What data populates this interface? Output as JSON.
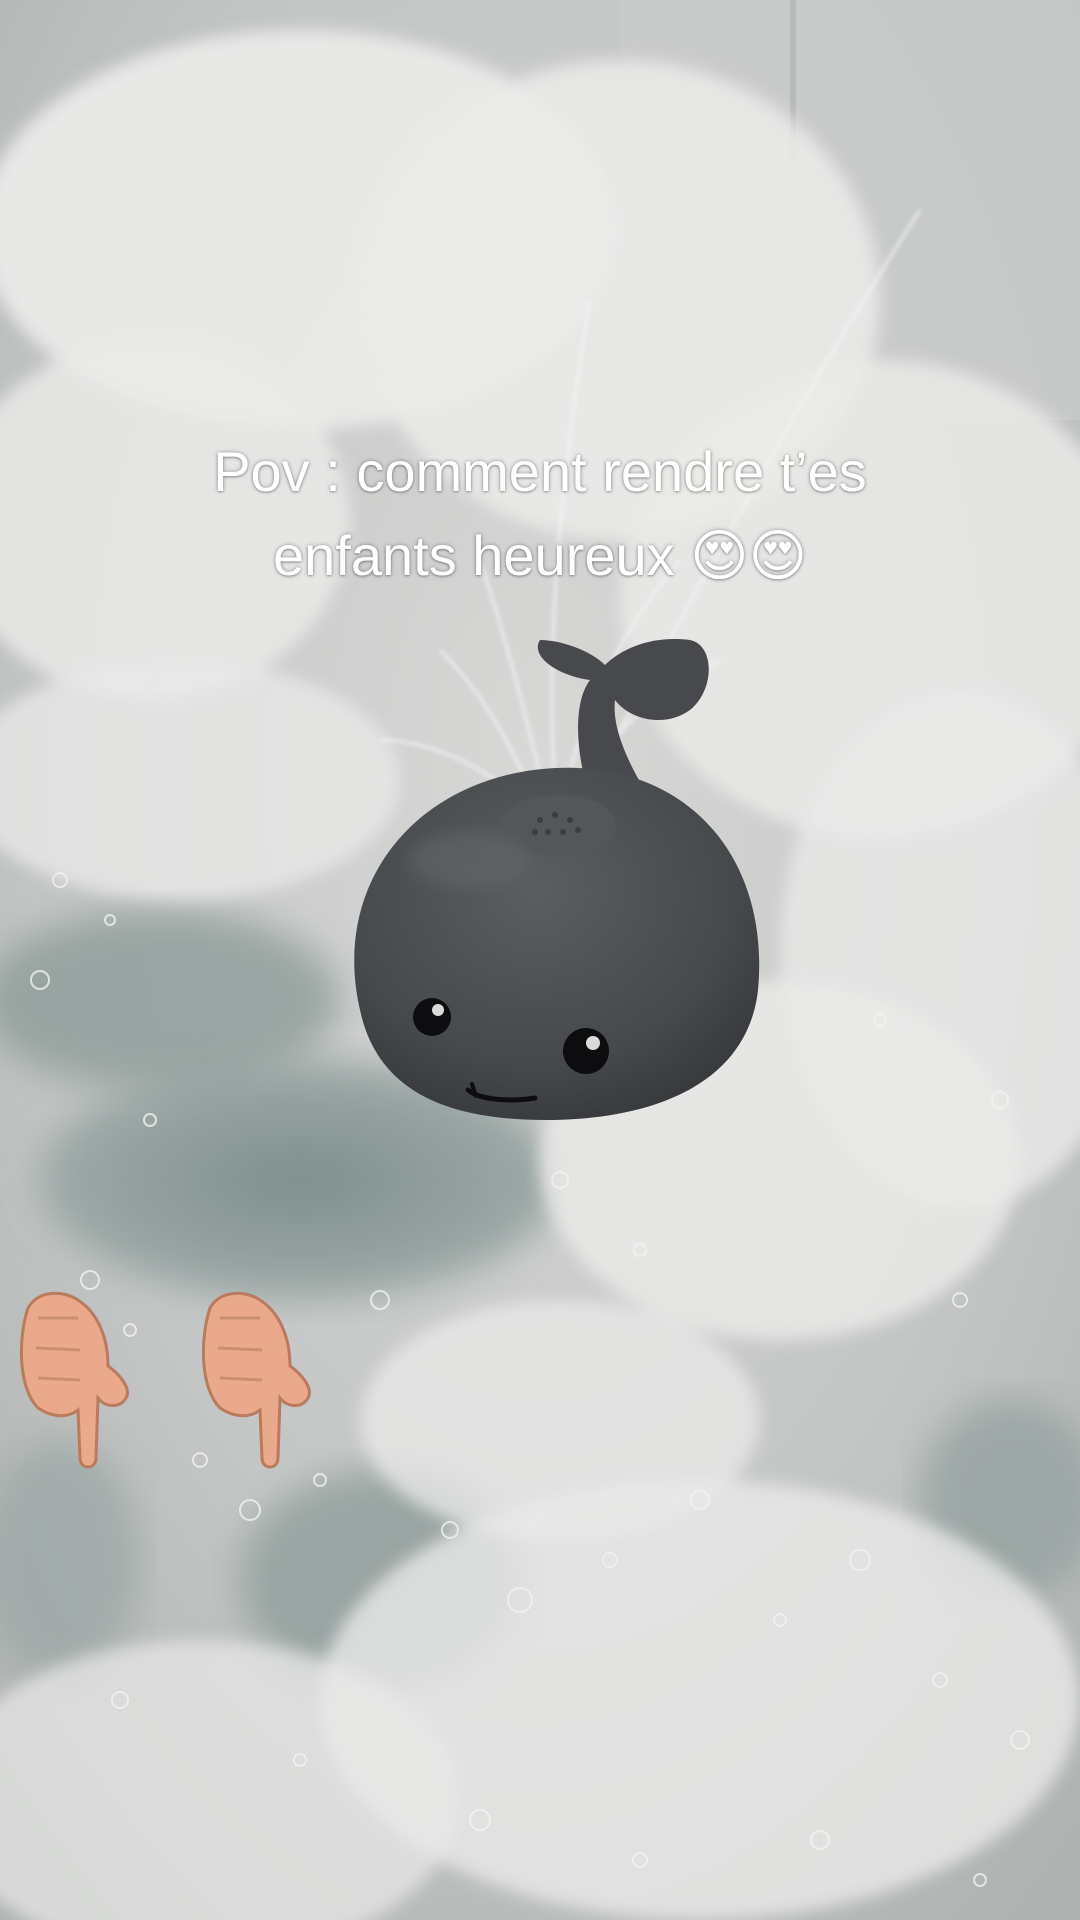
{
  "caption": {
    "line1": "Pov : comment rendre t’es",
    "line2": "enfants heureux",
    "emoji": "😍😍"
  },
  "icons": {
    "heart_eyes": "smiling-face-with-heart-eyes-icon",
    "pointing_down": "backhand-index-pointing-down-icon"
  },
  "colors": {
    "foam": "#e4e4e2",
    "water": "#8c9a98",
    "toy": "#474a4d",
    "caption_text": "#ffffff"
  }
}
